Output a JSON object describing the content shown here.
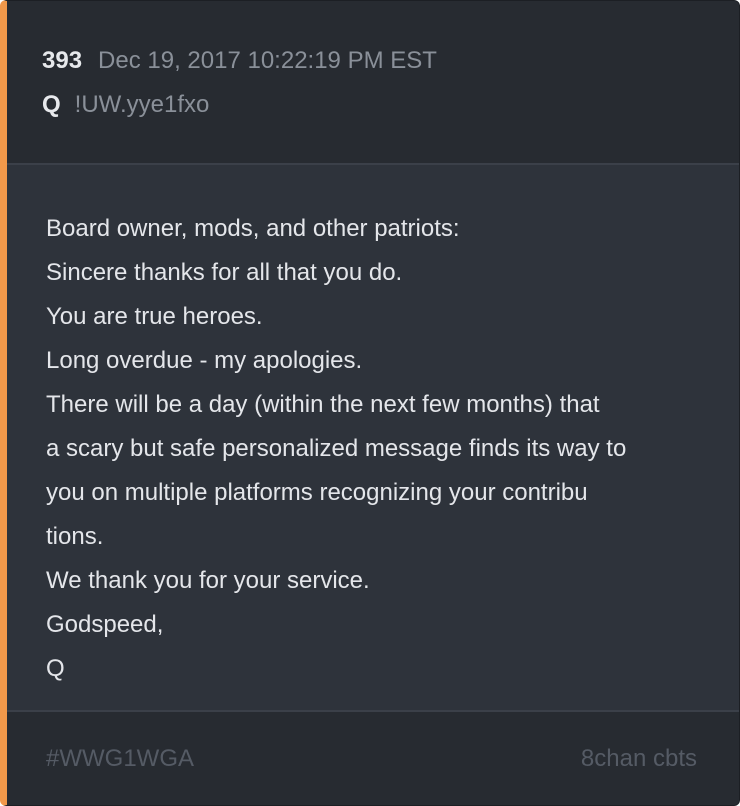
{
  "post": {
    "number": "393",
    "date": "Dec 19, 2017 10:22:19 PM EST",
    "author": "Q",
    "tripcode": "!UW.yye1fxo",
    "lines": [
      "Board owner, mods, and other patriots:",
      "Sincere thanks for all that you do.",
      "You are true heroes.",
      "Long overdue - my apologies.",
      "There will be a day (within the next few months) that",
      "a scary but safe personalized message finds its way to",
      "you on multiple platforms recognizing your contribu",
      "tions.",
      "We thank you for your service.",
      "Godspeed,",
      "Q"
    ]
  },
  "footer": {
    "hashtag": "#WWG1WGA",
    "source": "8chan cbts"
  },
  "colors": {
    "accent": "#f2994a",
    "card_bg": "#2e333b",
    "header_bg": "#272b31"
  }
}
